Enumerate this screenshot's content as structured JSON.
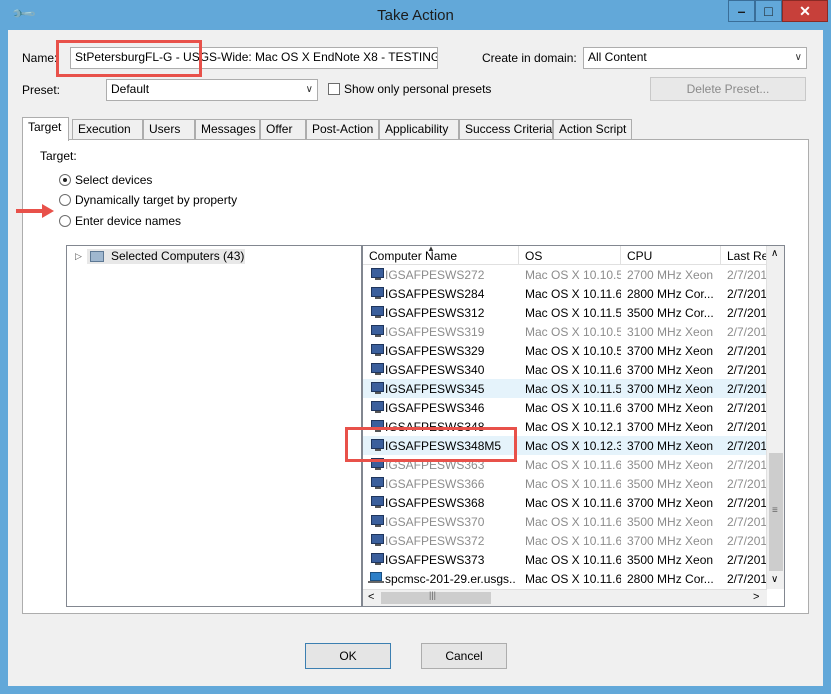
{
  "window": {
    "title": "Take Action"
  },
  "form": {
    "name_label": "Name:",
    "name_value": "StPetersburgFL-G - USGS-Wide: Mac OS X EndNote X8 - TESTING O",
    "domain_label": "Create in domain:",
    "domain_value": "All Content",
    "preset_label": "Preset:",
    "preset_value": "Default",
    "personal_presets_label": "Show only personal presets",
    "delete_preset_label": "Delete Preset..."
  },
  "tabs": [
    "Target",
    "Execution",
    "Users",
    "Messages",
    "Offer",
    "Post-Action",
    "Applicability",
    "Success Criteria",
    "Action Script"
  ],
  "target": {
    "heading": "Target:",
    "options": [
      "Select devices",
      "Dynamically target by property",
      "Enter device names"
    ]
  },
  "tree": {
    "root_label": "Selected Computers (43)"
  },
  "list": {
    "columns": [
      "Computer Name",
      "OS",
      "CPU",
      "Last Rep"
    ],
    "rows": [
      {
        "name": "IGSAFPESWS272",
        "os": "Mac OS X 10.10.5",
        "cpu": "2700 MHz Xeon",
        "last": "2/7/201"
      },
      {
        "name": "IGSAFPESWS284",
        "os": "Mac OS X 10.11.6",
        "cpu": "2800 MHz Cor...",
        "last": "2/7/201"
      },
      {
        "name": "IGSAFPESWS312",
        "os": "Mac OS X 10.11.5",
        "cpu": "3500 MHz Cor...",
        "last": "2/7/201"
      },
      {
        "name": "IGSAFPESWS319",
        "os": "Mac OS X 10.10.5",
        "cpu": "3100 MHz Xeon",
        "last": "2/7/201"
      },
      {
        "name": "IGSAFPESWS329",
        "os": "Mac OS X 10.10.5",
        "cpu": "3700 MHz Xeon",
        "last": "2/7/201"
      },
      {
        "name": "IGSAFPESWS340",
        "os": "Mac OS X 10.11.6",
        "cpu": "3700 MHz Xeon",
        "last": "2/7/201"
      },
      {
        "name": "IGSAFPESWS345",
        "os": "Mac OS X 10.11.5",
        "cpu": "3700 MHz Xeon",
        "last": "2/7/201"
      },
      {
        "name": "IGSAFPESWS346",
        "os": "Mac OS X 10.11.6",
        "cpu": "3700 MHz Xeon",
        "last": "2/7/201"
      },
      {
        "name": "IGSAFPESWS348",
        "os": "Mac OS X 10.12.1",
        "cpu": "3700 MHz Xeon",
        "last": "2/7/201"
      },
      {
        "name": "IGSAFPESWS348M5",
        "os": "Mac OS X 10.12.3",
        "cpu": "3700 MHz Xeon",
        "last": "2/7/201"
      },
      {
        "name": "IGSAFPESWS363",
        "os": "Mac OS X 10.11.6",
        "cpu": "3500 MHz Xeon",
        "last": "2/7/201"
      },
      {
        "name": "IGSAFPESWS366",
        "os": "Mac OS X 10.11.6",
        "cpu": "3500 MHz Xeon",
        "last": "2/7/201"
      },
      {
        "name": "IGSAFPESWS368",
        "os": "Mac OS X 10.11.6",
        "cpu": "3700 MHz Xeon",
        "last": "2/7/201"
      },
      {
        "name": "IGSAFPESWS370",
        "os": "Mac OS X 10.11.6",
        "cpu": "3500 MHz Xeon",
        "last": "2/7/201"
      },
      {
        "name": "IGSAFPESWS372",
        "os": "Mac OS X 10.11.6",
        "cpu": "3700 MHz Xeon",
        "last": "2/7/201"
      },
      {
        "name": "IGSAFPESWS373",
        "os": "Mac OS X 10.11.6",
        "cpu": "3500 MHz Xeon",
        "last": "2/7/201"
      },
      {
        "name": "spcmsc-201-29.er.usgs...",
        "os": "Mac OS X 10.11.6",
        "cpu": "2800 MHz Cor...",
        "last": "2/7/201"
      }
    ]
  },
  "buttons": {
    "ok": "OK",
    "cancel": "Cancel"
  },
  "colors": {
    "highlight": "#e8514a",
    "titlebar": "#62a8d9",
    "close": "#c7403a"
  }
}
